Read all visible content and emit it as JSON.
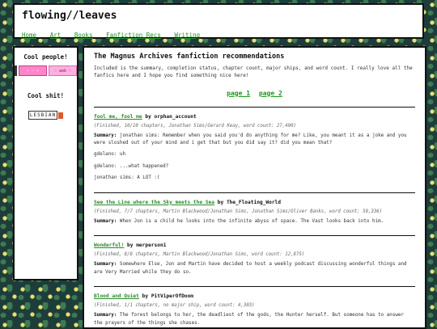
{
  "site": {
    "title": "flowing//leaves",
    "nav": [
      "Home",
      "Art",
      "Books",
      "Fanfiction Recs",
      "Writing"
    ]
  },
  "sidebar": {
    "cool_people": "Cool people!",
    "button1_text": "• ♡ •",
    "button2_text": "♡ web ♡",
    "cool_shit": "Cool shit!",
    "stamp_text": "LESBIAN"
  },
  "main": {
    "title": "The Magnus Archives fanfiction recommendations",
    "intro": "Included is the summary, completion status, chapter count, major ships, and word count. I really love all the fanfics here and I hope you find something nice here!",
    "pages": [
      "page 1",
      "page 2"
    ],
    "summary_label": "Summary:",
    "by": "by",
    "fics": [
      {
        "title": "fool me, fool me",
        "author": "orphan_account",
        "meta": "(Finished, 10/10 chapters, Jonathan Sims/Gerard Keay, word count: 27,490)",
        "summary": "jonathan sims: Remember when you said you'd do anything for me? Like, you meant it as a joke and you were sloshed out of your mind and i get that but you did say it? did you mean that?",
        "extra": [
          "gdelano: uh",
          "gdelano: ...what happened?",
          "jonathan sims: A LOT :("
        ]
      },
      {
        "title": "See the Line where the Sky meets the Sea",
        "author": "The_Floating_World",
        "meta": "(Finished, 7/7 chapters, Martin Blackwood/Jonathan Sims, Jonathan Sims/Oliver Banks, word count: 59,336)",
        "summary": "When Jon is a child he looks into the infinite abyss of space. The Vast looks back into him.",
        "extra": []
      },
      {
        "title": "Wonderful!",
        "author": "merperson1",
        "meta": "(Finished, 8/8 chapters, Martin Blackwood/Jonathan Sims, word count: 12,875)",
        "summary": "Somewhere Else, Jon and Martin have decided to host a weekly podcast discussing wonderful things and are Very Married while they do so.",
        "extra": []
      },
      {
        "title": "Blood and Quiet",
        "author": "PitViperOfDoom",
        "meta": "(Finished, 1/1 chapters, no major ship, word count: 4,303)",
        "summary": "The forest belongs to her, the deadliest of the gods, the Hunter herself. But someone has to answer the prayers of the things she chases.",
        "extra": []
      }
    ]
  }
}
